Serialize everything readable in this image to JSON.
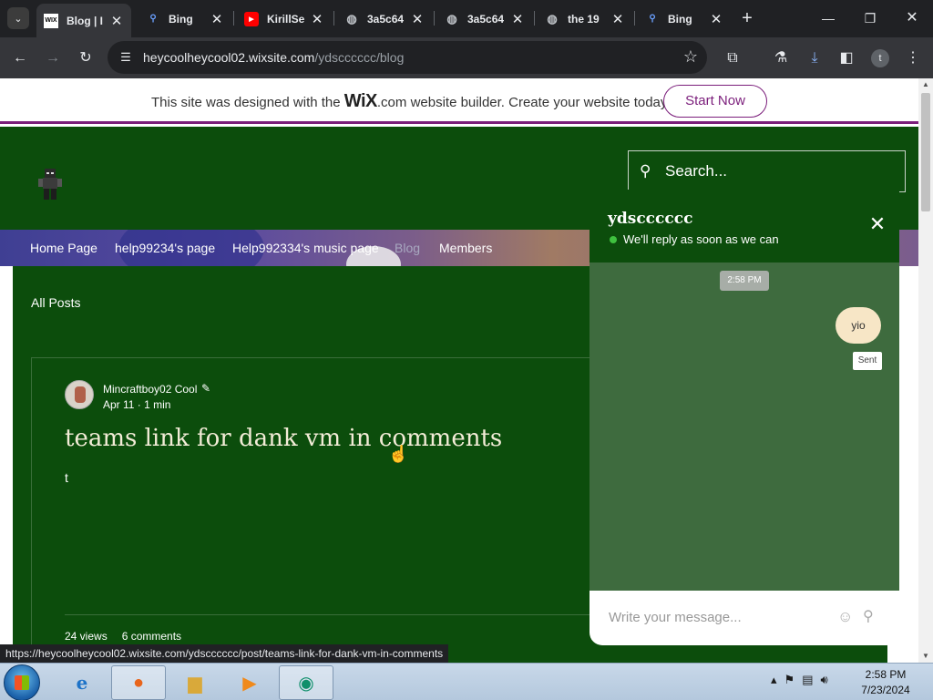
{
  "browser": {
    "tabs": [
      {
        "title": "Blog | I",
        "icon": "wix-favicon-icon",
        "active": true
      },
      {
        "title": "Bing",
        "icon": "search-icon",
        "active": false
      },
      {
        "title": "KirillSe",
        "icon": "youtube-icon",
        "active": false
      },
      {
        "title": "3a5c64",
        "icon": "globe-icon",
        "active": false
      },
      {
        "title": "3a5c64",
        "icon": "globe-icon",
        "active": false
      },
      {
        "title": "the 19",
        "icon": "globe-icon",
        "active": false
      },
      {
        "title": "Bing",
        "icon": "search-icon",
        "active": false
      }
    ],
    "url_host": "heycoolheycool02.wixsite.com",
    "url_path": "/ydscccccc/blog",
    "profile_initial": "t"
  },
  "wix_banner": {
    "text_before": "This site was designed with the ",
    "logo": "WiX",
    "text_after": ".com website builder. Create your website today.",
    "button": "Start Now"
  },
  "site": {
    "search_placeholder": "Search...",
    "nav": [
      "Home Page",
      "help99234's page",
      "Help992334's music page",
      "Blog",
      "Members"
    ],
    "nav_current": "Blog"
  },
  "blog": {
    "all_posts": "All Posts",
    "post": {
      "author": "Mincraftboy02 Cool",
      "date": "Apr 11",
      "read_time": "1 min",
      "title": "teams link for dank vm in comments",
      "excerpt": "t",
      "views": "24 views",
      "comments": "6 comments"
    }
  },
  "chat": {
    "title": "ydscccccc",
    "status": "We'll reply as soon as we can",
    "time": "2:58 PM",
    "message": "yio",
    "message_status": "Sent",
    "input_placeholder": "Write your message..."
  },
  "status_url": "https://heycoolheycool02.wixsite.com/ydscccccc/post/teams-link-for-dank-vm-in-comments",
  "taskbar": {
    "time": "2:58 PM",
    "date": "7/23/2024"
  },
  "colors": {
    "site_green": "#0c4d0c",
    "chat_body": "#3e6b3e",
    "wix_accent": "#7b1e7b",
    "bubble": "#f7e6c6"
  }
}
